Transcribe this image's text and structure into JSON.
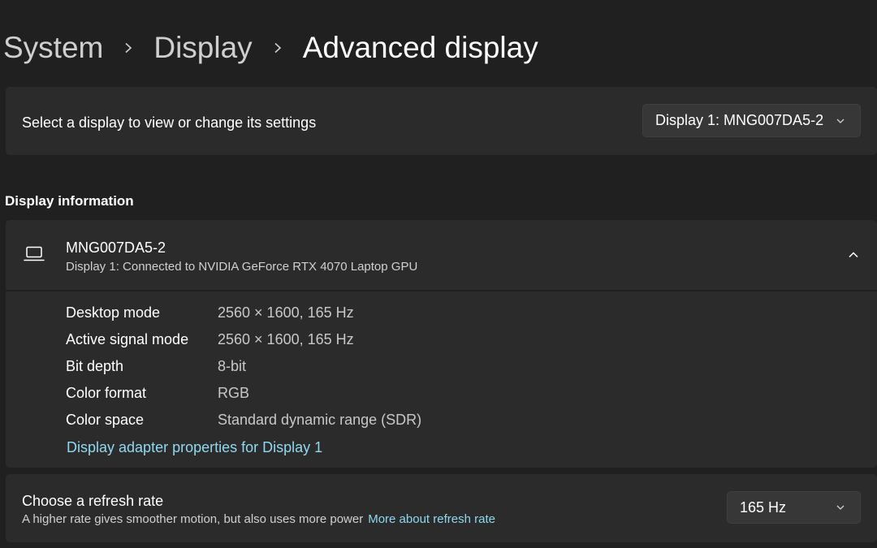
{
  "breadcrumb": {
    "items": [
      "System",
      "Display"
    ],
    "current": "Advanced display"
  },
  "display_selector": {
    "label": "Select a display to view or change its settings",
    "selected": "Display 1: MNG007DA5-2"
  },
  "display_information": {
    "section_title": "Display information",
    "monitor_name": "MNG007DA5-2",
    "connection": "Display 1: Connected to NVIDIA GeForce RTX 4070 Laptop GPU",
    "icon": "laptop-icon",
    "properties": [
      {
        "label": "Desktop mode",
        "value": "2560 × 1600, 165 Hz"
      },
      {
        "label": "Active signal mode",
        "value": "2560 × 1600, 165 Hz"
      },
      {
        "label": "Bit depth",
        "value": "8-bit"
      },
      {
        "label": "Color format",
        "value": "RGB"
      },
      {
        "label": "Color space",
        "value": "Standard dynamic range (SDR)"
      }
    ],
    "adapter_link": "Display adapter properties for Display 1"
  },
  "refresh_rate": {
    "title": "Choose a refresh rate",
    "description": "A higher rate gives smoother motion, but also uses more power",
    "link": "More about refresh rate",
    "selected": "165 Hz"
  },
  "colors": {
    "background": "#202020",
    "card": "#2b2b2b",
    "accent_link": "#8fd8f0"
  }
}
